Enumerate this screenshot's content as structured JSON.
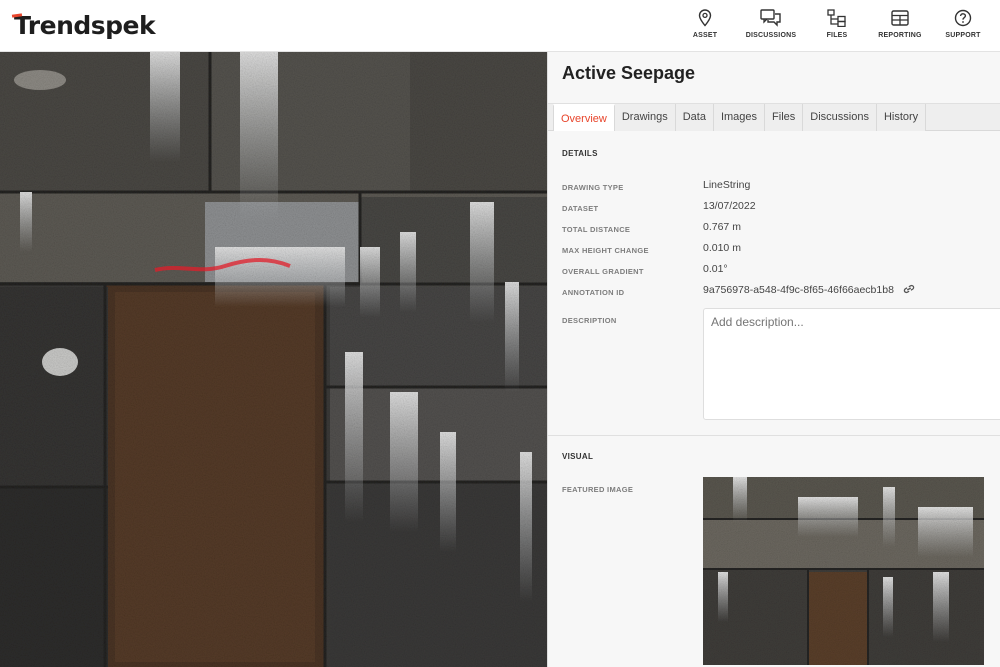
{
  "app": {
    "logo_text": "Trendspek",
    "brand_color": "#e8452c"
  },
  "nav": [
    {
      "label": "ASSET",
      "icon": "map-pin-icon"
    },
    {
      "label": "DISCUSSIONS",
      "icon": "chat-bubbles-icon"
    },
    {
      "label": "FILES",
      "icon": "folder-tree-icon"
    },
    {
      "label": "REPORTING",
      "icon": "table-icon"
    },
    {
      "label": "SUPPORT",
      "icon": "help-circle-icon"
    }
  ],
  "panel": {
    "title": "Active Seepage",
    "tabs": [
      "Overview",
      "Drawings",
      "Data",
      "Images",
      "Files",
      "Discussions",
      "History"
    ],
    "active_tab": "Overview",
    "details_heading": "DETAILS",
    "details": [
      {
        "label": "DRAWING TYPE",
        "value": "LineString"
      },
      {
        "label": "DATASET",
        "value": "13/07/2022"
      },
      {
        "label": "TOTAL DISTANCE",
        "value": "0.767 m"
      },
      {
        "label": "MAX HEIGHT CHANGE",
        "value": "0.010 m"
      },
      {
        "label": "OVERALL GRADIENT",
        "value": "0.01°"
      },
      {
        "label": "ANNOTATION ID",
        "value": "9a756978-a548-4f9c-8f65-46f66aecb1b8"
      }
    ],
    "description_label": "DESCRIPTION",
    "description_placeholder": "Add description...",
    "visual_heading": "VISUAL",
    "featured_image_label": "FEATURED IMAGE"
  }
}
